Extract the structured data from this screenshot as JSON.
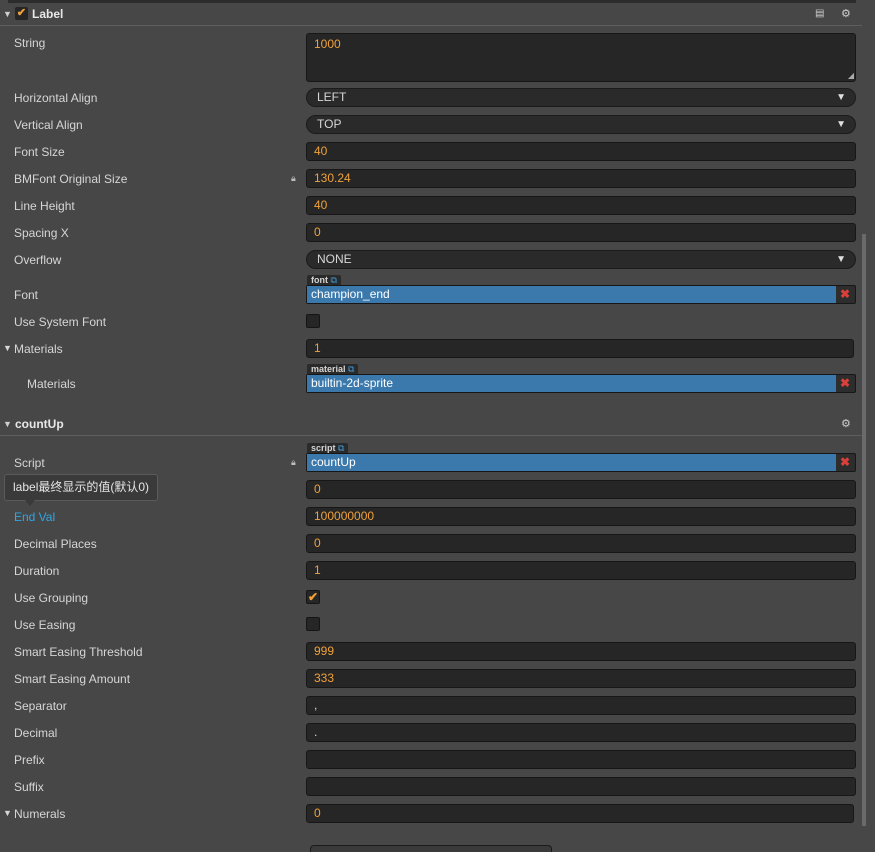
{
  "label_component": {
    "title": "Label",
    "enabled": true,
    "props": {
      "string": {
        "label": "String",
        "value": "1000"
      },
      "horizontal_align": {
        "label": "Horizontal Align",
        "value": "LEFT"
      },
      "vertical_align": {
        "label": "Vertical Align",
        "value": "TOP"
      },
      "font_size": {
        "label": "Font Size",
        "value": "40"
      },
      "bmfont_original_size": {
        "label": "BMFont Original Size",
        "value": "130.24"
      },
      "line_height": {
        "label": "Line Height",
        "value": "40"
      },
      "spacing_x": {
        "label": "Spacing X",
        "value": "0"
      },
      "overflow": {
        "label": "Overflow",
        "value": "NONE"
      },
      "font": {
        "label": "Font",
        "tag": "font",
        "value": "champion_end"
      },
      "use_system_font": {
        "label": "Use System Font",
        "checked": false
      },
      "materials": {
        "label": "Materials",
        "value": "1"
      },
      "materials_item": {
        "label": "Materials",
        "tag": "material",
        "value": "builtin-2d-sprite"
      }
    }
  },
  "countup_component": {
    "title": "countUp",
    "tooltip": "label最终显示的值(默认0)",
    "props": {
      "script": {
        "label": "Script",
        "tag": "script",
        "value": "countUp"
      },
      "start_val": {
        "value": "0"
      },
      "end_val": {
        "label": "End Val",
        "value": "100000000"
      },
      "decimal_places": {
        "label": "Decimal Places",
        "value": "0"
      },
      "duration": {
        "label": "Duration",
        "value": "1"
      },
      "use_grouping": {
        "label": "Use Grouping",
        "checked": true
      },
      "use_easing": {
        "label": "Use Easing",
        "checked": false
      },
      "smart_easing_threshold": {
        "label": "Smart Easing Threshold",
        "value": "999"
      },
      "smart_easing_amount": {
        "label": "Smart Easing Amount",
        "value": "333"
      },
      "separator": {
        "label": "Separator",
        "value": ","
      },
      "decimal": {
        "label": "Decimal",
        "value": "."
      },
      "prefix": {
        "label": "Prefix",
        "value": ""
      },
      "suffix": {
        "label": "Suffix",
        "value": ""
      },
      "numerals": {
        "label": "Numerals",
        "value": "0"
      }
    }
  },
  "icons": {
    "tri": "▼",
    "check": "✔",
    "lock": "🔒",
    "gear": "⚙",
    "book": "📖",
    "remove": "✖",
    "external": "⧉",
    "resize": "◢"
  }
}
